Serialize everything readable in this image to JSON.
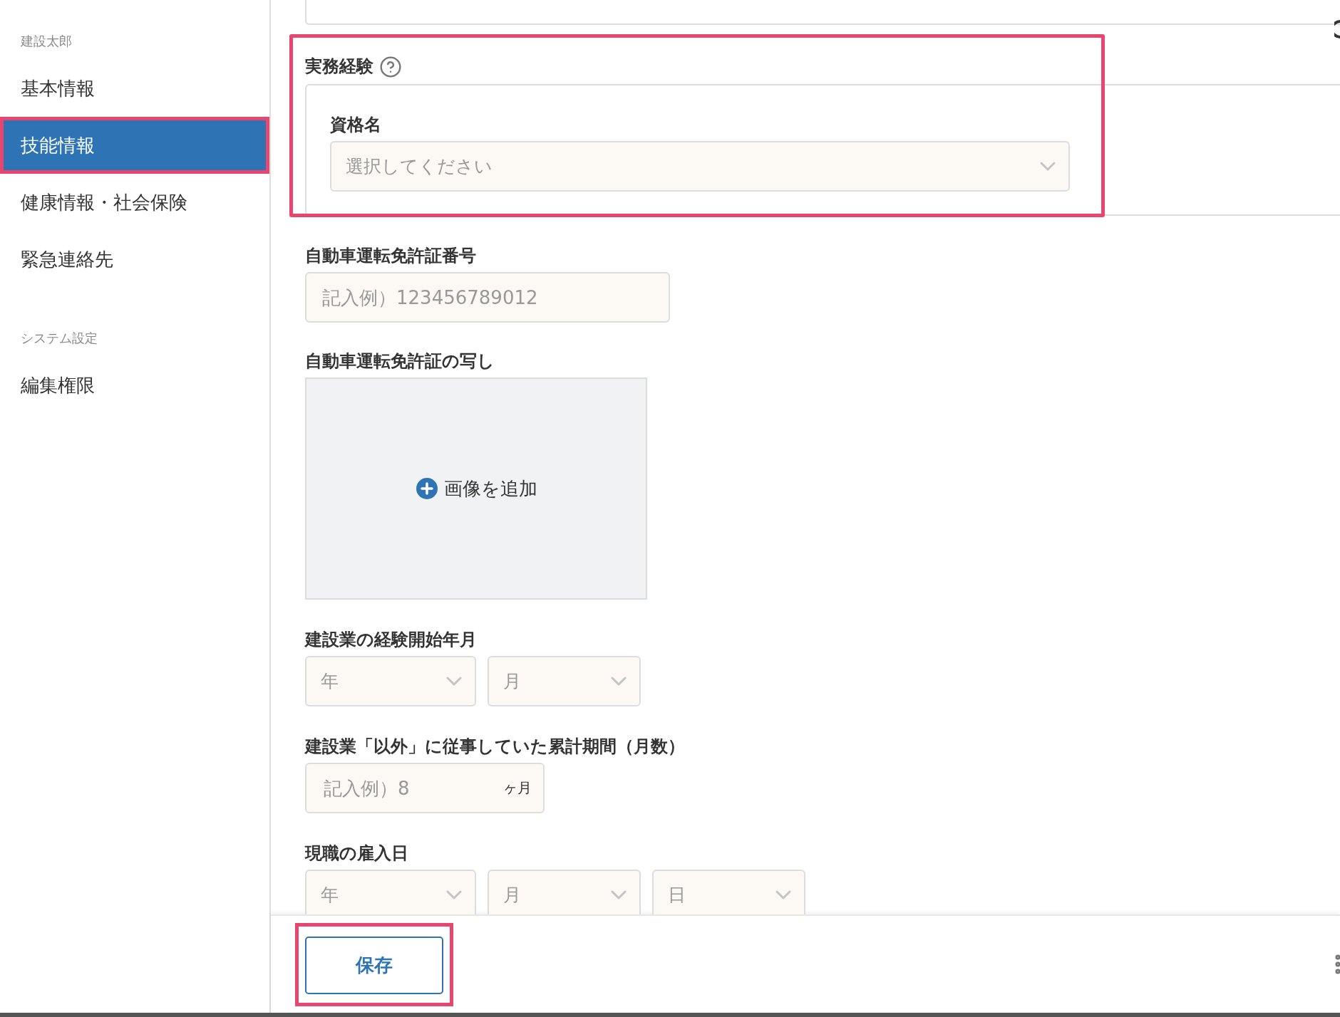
{
  "sidebar": {
    "user_name": "建設太郎",
    "items": [
      {
        "label": "基本情報",
        "selected": false,
        "highlighted": false
      },
      {
        "label": "技能情報",
        "selected": true,
        "highlighted": true
      },
      {
        "label": "健康情報・社会保険",
        "selected": false,
        "highlighted": false
      },
      {
        "label": "緊急連絡先",
        "selected": false,
        "highlighted": false
      }
    ],
    "section_title": "システム設定",
    "settings_items": [
      {
        "label": "編集権限",
        "selected": false,
        "highlighted": false
      }
    ]
  },
  "form": {
    "experience": {
      "label": "実務経験",
      "highlighted": true,
      "qualification": {
        "label": "資格名",
        "placeholder": "選択してください"
      }
    },
    "license_number": {
      "label": "自動車運転免許証番号",
      "placeholder": "記入例）123456789012"
    },
    "license_copy": {
      "label": "自動車運転免許証の写し",
      "add_label": "画像を追加"
    },
    "experience_start": {
      "label": "建設業の経験開始年月",
      "selects": [
        {
          "placeholder": "年"
        },
        {
          "placeholder": "月"
        }
      ]
    },
    "other_months": {
      "label": "建設業「以外」に従事していた累計期間（月数）",
      "placeholder": "記入例）8",
      "unit": "ヶ月"
    },
    "hire_date": {
      "label": "現職の雇入日",
      "selects": [
        {
          "placeholder": "年"
        },
        {
          "placeholder": "月"
        },
        {
          "placeholder": "日"
        }
      ]
    }
  },
  "footer": {
    "save_button": {
      "label": "保存",
      "highlighted": true
    }
  }
}
